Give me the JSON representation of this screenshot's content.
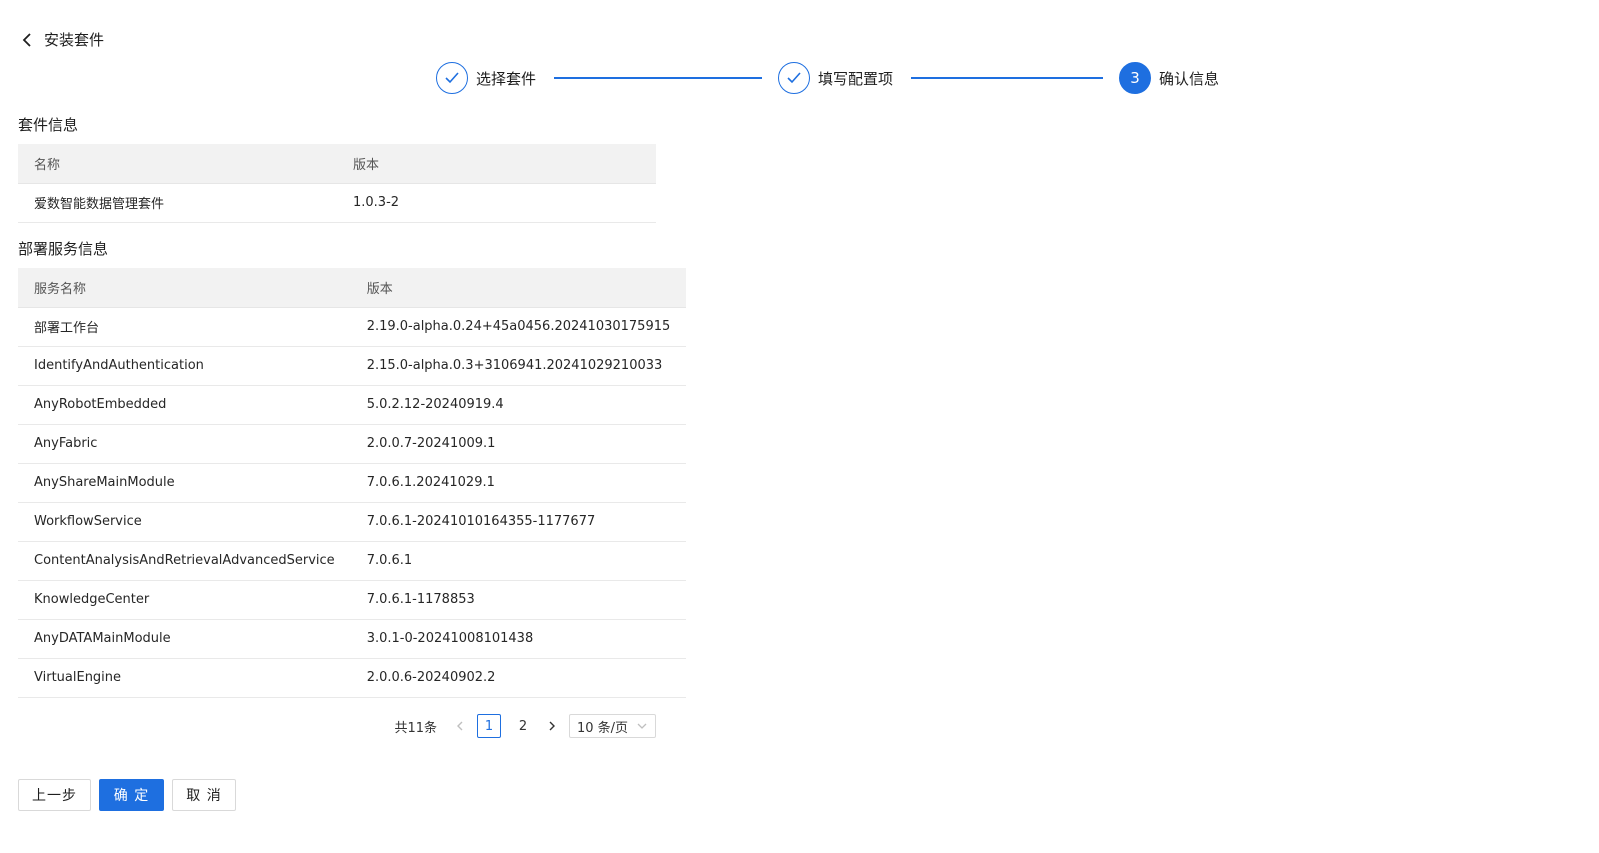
{
  "header": {
    "back_title": "安装套件"
  },
  "steps": [
    {
      "label": "选择套件",
      "state": "done",
      "number": "1"
    },
    {
      "label": "填写配置项",
      "state": "done",
      "number": "2"
    },
    {
      "label": "确认信息",
      "state": "active",
      "number": "3"
    }
  ],
  "suite_section": {
    "title": "套件信息",
    "columns": [
      "名称",
      "版本"
    ],
    "rows": [
      [
        "爱数智能数据管理套件",
        "1.0.3-2"
      ]
    ]
  },
  "service_section": {
    "title": "部署服务信息",
    "columns": [
      "服务名称",
      "版本"
    ],
    "rows": [
      [
        "部署工作台",
        "2.19.0-alpha.0.24+45a0456.20241030175915"
      ],
      [
        "IdentifyAndAuthentication",
        "2.15.0-alpha.0.3+3106941.20241029210033"
      ],
      [
        "AnyRobotEmbedded",
        "5.0.2.12-20240919.4"
      ],
      [
        "AnyFabric",
        "2.0.0.7-20241009.1"
      ],
      [
        "AnyShareMainModule",
        "7.0.6.1.20241029.1"
      ],
      [
        "WorkflowService",
        "7.0.6.1-20241010164355-1177677"
      ],
      [
        "ContentAnalysisAndRetrievalAdvancedService",
        "7.0.6.1"
      ],
      [
        "KnowledgeCenter",
        "7.0.6.1-1178853"
      ],
      [
        "AnyDATAMainModule",
        "3.0.1-0-20241008101438"
      ],
      [
        "VirtualEngine",
        "2.0.0.6-20240902.2"
      ]
    ]
  },
  "pagination": {
    "total": "共11条",
    "pages": [
      "1",
      "2"
    ],
    "current": "1",
    "page_size": "10 条/页"
  },
  "buttons": {
    "prev": "上一步",
    "confirm": "确 定",
    "cancel": "取 消"
  },
  "colors": {
    "accent": "#1e6fe0"
  }
}
